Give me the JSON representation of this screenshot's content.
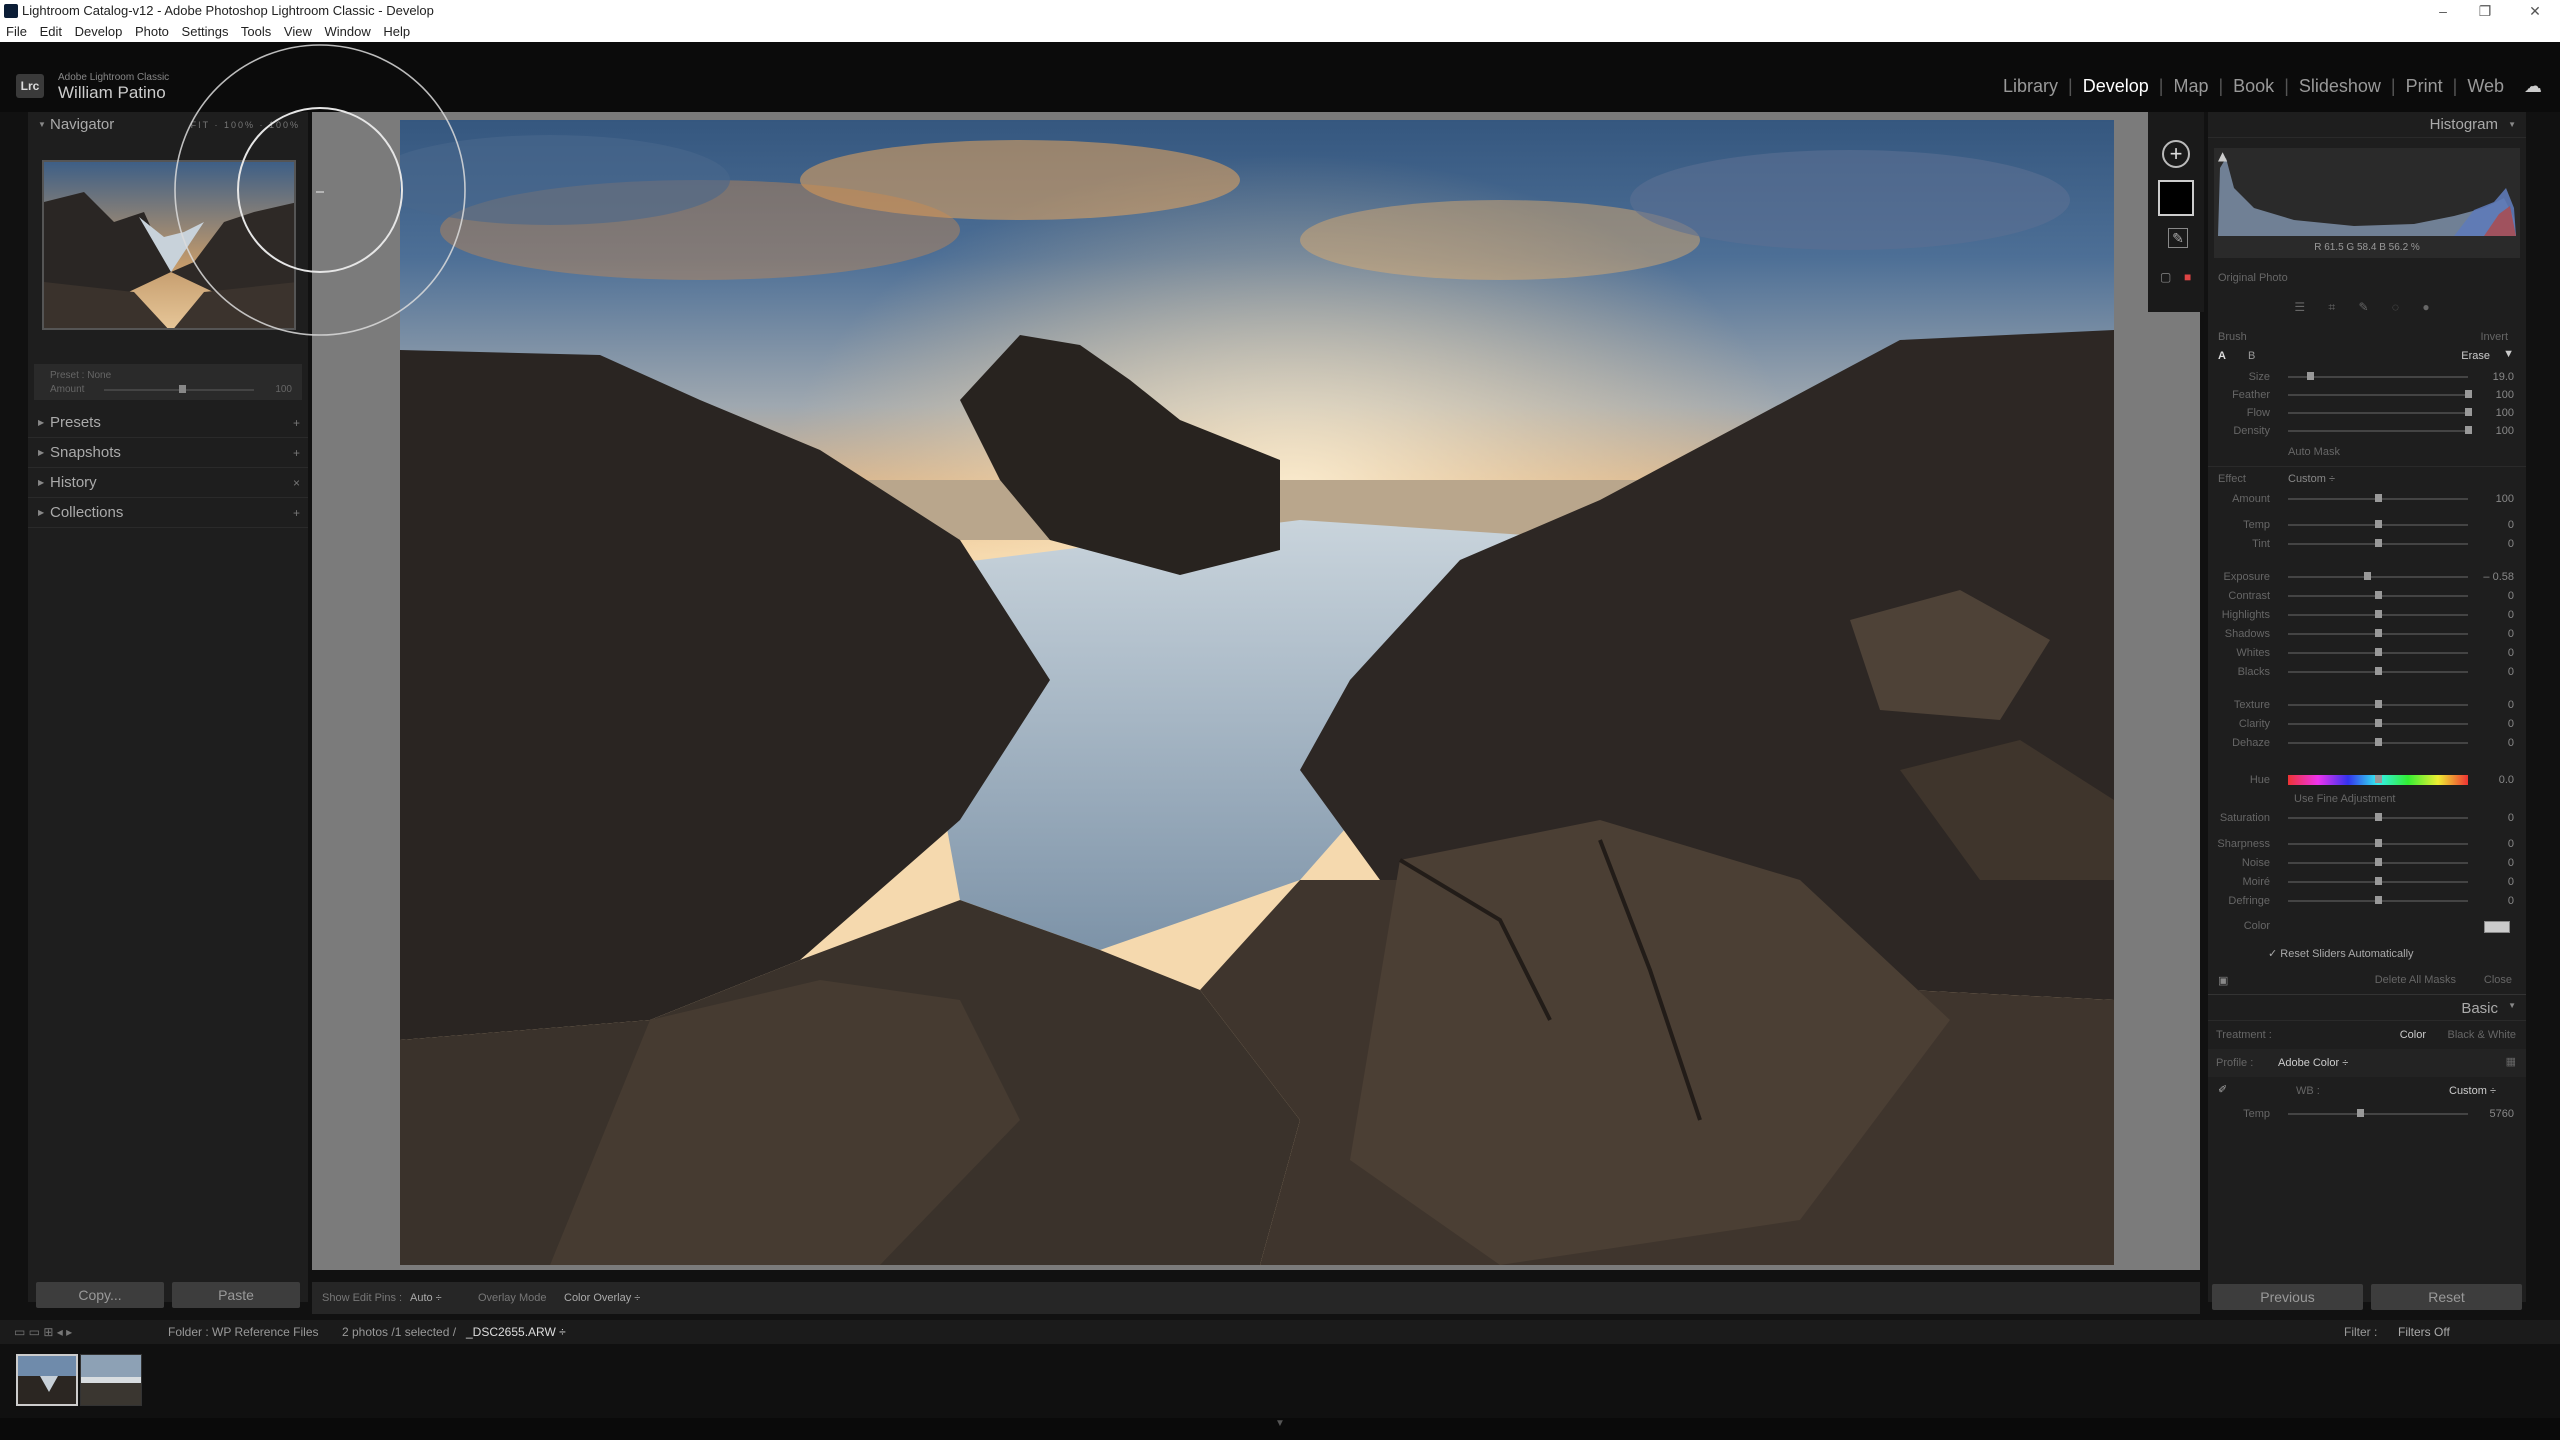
{
  "window": {
    "title": "Lightroom Catalog-v12 - Adobe Photoshop Lightroom Classic - Develop",
    "controls": [
      "–",
      "❐",
      "✕"
    ]
  },
  "menubar": [
    "File",
    "Edit",
    "Develop",
    "Photo",
    "Settings",
    "Tools",
    "View",
    "Window",
    "Help"
  ],
  "identity": {
    "logo": "Lrc",
    "product": "Adobe Lightroom Classic",
    "user": "William Patino"
  },
  "modules": [
    "Library",
    "Develop",
    "Map",
    "Book",
    "Slideshow",
    "Print",
    "Web"
  ],
  "active_module": "Develop",
  "left_panel": {
    "navigator": {
      "title": "Navigator",
      "zoom": "FIT · 100% · 100%"
    },
    "preset_row": {
      "label_a": "Preset",
      "label_b": "None",
      "amount_label": "Amount",
      "amount_value": "100"
    },
    "sections": [
      "Presets",
      "Snapshots",
      "History",
      "Collections"
    ],
    "copy": "Copy...",
    "paste": "Paste"
  },
  "toolbar": {
    "show_edit_pins_label": "Show Edit Pins :",
    "show_edit_pins_value": "Auto ÷",
    "overlay_mode_label": "Overlay Mode",
    "overlay_mode_value": "Color Overlay ÷"
  },
  "right_panel": {
    "histogram": {
      "title": "Histogram",
      "readout": "R  61.5   G  58.4   B  56.2  %",
      "original_photo": "Original Photo"
    },
    "brush": {
      "title": "Brush",
      "invert": "Invert",
      "a": "A",
      "b": "B",
      "erase": "Erase",
      "rows": [
        {
          "label": "Size",
          "value": "19.0",
          "pos": 0.12
        },
        {
          "label": "Feather",
          "value": "100",
          "pos": 1.0
        },
        {
          "label": "Flow",
          "value": "100",
          "pos": 1.0
        },
        {
          "label": "Density",
          "value": "100",
          "pos": 1.0
        }
      ],
      "auto_mask": "Auto Mask"
    },
    "effect": {
      "title": "Effect",
      "preset": "Custom ÷",
      "amount": {
        "label": "Amount",
        "value": "100",
        "pos": 0.5
      },
      "rows": [
        {
          "label": "Temp",
          "value": "0",
          "pos": 0.5
        },
        {
          "label": "Tint",
          "value": "0",
          "pos": 0.5
        },
        {
          "label": "Exposure",
          "value": "– 0.58",
          "pos": 0.44
        },
        {
          "label": "Contrast",
          "value": "0",
          "pos": 0.5
        },
        {
          "label": "Highlights",
          "value": "0",
          "pos": 0.5
        },
        {
          "label": "Shadows",
          "value": "0",
          "pos": 0.5
        },
        {
          "label": "Whites",
          "value": "0",
          "pos": 0.5
        },
        {
          "label": "Blacks",
          "value": "0",
          "pos": 0.5
        },
        {
          "label": "Texture",
          "value": "0",
          "pos": 0.5
        },
        {
          "label": "Clarity",
          "value": "0",
          "pos": 0.5
        },
        {
          "label": "Dehaze",
          "value": "0",
          "pos": 0.5
        }
      ],
      "hue": {
        "label": "Hue",
        "value": "0.0",
        "pos": 0.5
      },
      "use_fine_adjustment": "Use Fine Adjustment",
      "saturation": {
        "label": "Saturation",
        "value": "0",
        "pos": 0.5
      },
      "detail_rows": [
        {
          "label": "Sharpness",
          "value": "0",
          "pos": 0.5
        },
        {
          "label": "Noise",
          "value": "0",
          "pos": 0.5
        },
        {
          "label": "Moiré",
          "value": "0",
          "pos": 0.5
        },
        {
          "label": "Defringe",
          "value": "0",
          "pos": 0.5
        }
      ],
      "color_label": "Color",
      "reset_sliders": "Reset Sliders Automatically",
      "delete_all_masks": "Delete All Masks",
      "close": "Close"
    },
    "basic": {
      "title": "Basic",
      "treatment_label": "Treatment :",
      "color": "Color",
      "bw": "Black & White",
      "profile_label": "Profile :",
      "profile_value": "Adobe Color ÷",
      "wb_label": "WB :",
      "wb_value": "Custom ÷",
      "temp_label": "Temp",
      "temp_value": "5760",
      "temp_pos": 0.4
    },
    "previous": "Previous",
    "reset": "Reset"
  },
  "filmstrip": {
    "folder": "Folder : WP Reference Files",
    "count": "2 photos /1 selected /",
    "filename": "_DSC2655.ARW ÷",
    "filter_label": "Filter :",
    "filter_value": "Filters Off"
  },
  "icons": [
    "close-icon",
    "minimize-icon",
    "restore-icon",
    "cloud-icon",
    "plus-icon",
    "chevron-down-icon",
    "triangle-icon",
    "brush-icon"
  ]
}
